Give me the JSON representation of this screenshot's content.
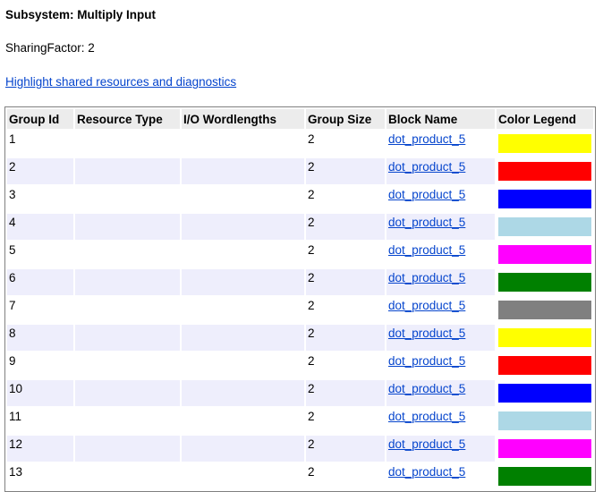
{
  "title": "Subsystem: Multiply Input",
  "sharing_factor": "SharingFactor: 2",
  "highlight_link": "Highlight shared resources and diagnostics ",
  "table": {
    "headers": [
      "Group Id",
      "Resource Type",
      "I/O Wordlengths",
      "Group Size",
      "Block Name",
      "Color Legend"
    ],
    "rows": [
      {
        "id": "1",
        "resource": "",
        "io": "",
        "size": "2",
        "block": "dot_product_5",
        "color": "#ffff00"
      },
      {
        "id": "2",
        "resource": "",
        "io": "",
        "size": "2",
        "block": "dot_product_5",
        "color": "#ff0000"
      },
      {
        "id": "3",
        "resource": "",
        "io": "",
        "size": "2",
        "block": "dot_product_5",
        "color": "#0000ff"
      },
      {
        "id": "4",
        "resource": "",
        "io": "",
        "size": "2",
        "block": "dot_product_5",
        "color": "#add8e6"
      },
      {
        "id": "5",
        "resource": "",
        "io": "",
        "size": "2",
        "block": "dot_product_5",
        "color": "#ff00ff"
      },
      {
        "id": "6",
        "resource": "",
        "io": "",
        "size": "2",
        "block": "dot_product_5",
        "color": "#008000"
      },
      {
        "id": "7",
        "resource": "",
        "io": "",
        "size": "2",
        "block": "dot_product_5",
        "color": "#808080"
      },
      {
        "id": "8",
        "resource": "",
        "io": "",
        "size": "2",
        "block": "dot_product_5",
        "color": "#ffff00"
      },
      {
        "id": "9",
        "resource": "",
        "io": "",
        "size": "2",
        "block": "dot_product_5",
        "color": "#ff0000"
      },
      {
        "id": "10",
        "resource": "",
        "io": "",
        "size": "2",
        "block": "dot_product_5",
        "color": "#0000ff"
      },
      {
        "id": "11",
        "resource": "",
        "io": "",
        "size": "2",
        "block": "dot_product_5",
        "color": "#add8e6"
      },
      {
        "id": "12",
        "resource": "",
        "io": "",
        "size": "2",
        "block": "dot_product_5",
        "color": "#ff00ff"
      },
      {
        "id": "13",
        "resource": "",
        "io": "",
        "size": "2",
        "block": "dot_product_5",
        "color": "#008000"
      }
    ]
  }
}
